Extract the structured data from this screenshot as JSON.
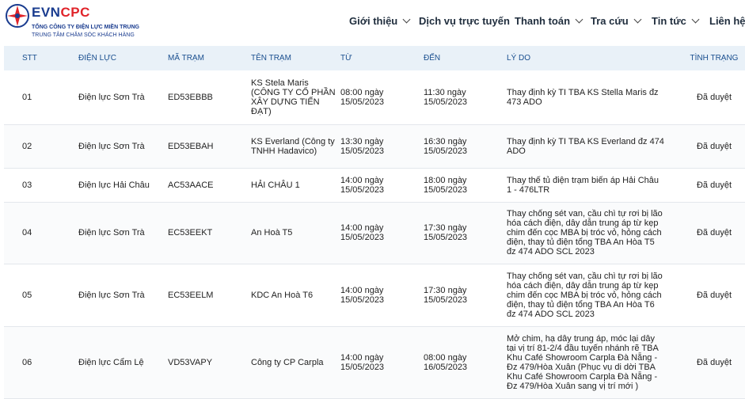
{
  "brand": {
    "evn": "EVN",
    "cpc": "CPC",
    "company": "TỔNG CÔNG TY ĐIỆN LỰC MIỀN TRUNG",
    "center": "TRUNG TÂM CHĂM SÓC KHÁCH HÀNG"
  },
  "nav": {
    "items": [
      {
        "label": "Giới thiệu",
        "dropdown": true
      },
      {
        "label": "Dịch vụ trực tuyến",
        "dropdown": false
      },
      {
        "label": "Thanh toán",
        "dropdown": true
      },
      {
        "label": "Tra cứu",
        "dropdown": true
      },
      {
        "label": "Tin tức",
        "dropdown": true
      },
      {
        "label": "Liên hệ",
        "dropdown": false
      }
    ]
  },
  "table": {
    "headers": [
      "STT",
      "ĐIỆN LỰC",
      "MÃ TRẠM",
      "TÊN TRẠM",
      "TỪ",
      "ĐẾN",
      "LÝ DO",
      "TÌNH TRẠNG"
    ],
    "rows": [
      {
        "stt": "01",
        "dien_luc": "Điện lực Sơn Trà",
        "ma_tram": "ED53EBBB",
        "ten_tram": "KS Stela Maris (CÔNG TY CỔ PHẦN XÂY DỰNG TIẾN ĐẠT)",
        "tu": "08:00 ngày 15/05/2023",
        "den": "11:30 ngày 15/05/2023",
        "ly_do": "Thay định kỳ TI TBA KS Stella Maris đz 473 ADO",
        "tinh_trang": "Đã duyệt"
      },
      {
        "stt": "02",
        "dien_luc": "Điện lực Sơn Trà",
        "ma_tram": "ED53EBAH",
        "ten_tram": "KS Everland (Công ty TNHH Hadavico)",
        "tu": "13:30 ngày 15/05/2023",
        "den": "16:30 ngày 15/05/2023",
        "ly_do": "Thay định kỳ TI TBA KS Everland đz 474 ADO",
        "tinh_trang": "Đã duyệt"
      },
      {
        "stt": "03",
        "dien_luc": "Điện lực Hải Châu",
        "ma_tram": "AC53AACE",
        "ten_tram": "HẢI CHÂU 1",
        "tu": "14:00 ngày 15/05/2023",
        "den": "18:00 ngày 15/05/2023",
        "ly_do": "Thay thế tủ điện trạm biến áp Hải Châu 1 - 476LTR",
        "tinh_trang": "Đã duyệt"
      },
      {
        "stt": "04",
        "dien_luc": "Điện lực Sơn Trà",
        "ma_tram": "EC53EEKT",
        "ten_tram": "An Hoà T5",
        "tu": "14:00 ngày 15/05/2023",
        "den": "17:30 ngày 15/05/2023",
        "ly_do": "Thay chống sét van, cầu chì tự rơi bị lão hóa cách điện, dây dẫn trung áp từ kẹp chim đến cọc MBA bị tróc vỏ, hỏng cách điện, thay tủ điện tổng TBA An Hòa T5 đz 474 ADO SCL 2023",
        "tinh_trang": "Đã duyệt"
      },
      {
        "stt": "05",
        "dien_luc": "Điện lực Sơn Trà",
        "ma_tram": "EC53EELM",
        "ten_tram": "KDC An Hoà T6",
        "tu": "14:00 ngày 15/05/2023",
        "den": "17:30 ngày 15/05/2023",
        "ly_do": "Thay chống sét van, cầu chì tự rơi bị lão hóa cách điện, dây dẫn trung áp từ kẹp chim đến cọc MBA bị tróc vỏ, hỏng cách điện, thay tủ điện tổng TBA An Hòa T6 đz 474 ADO SCL 2023",
        "tinh_trang": "Đã duyệt"
      },
      {
        "stt": "06",
        "dien_luc": "Điện lực Cẩm Lệ",
        "ma_tram": "VD53VAPY",
        "ten_tram": "Công ty CP Carpla",
        "tu": "14:00 ngày 15/05/2023",
        "den": "08:00 ngày 16/05/2023",
        "ly_do": "Mở chim, hạ dây trung áp, móc lại dây tại vị trí 81-2/4 đầu tuyến nhánh rẽ TBA Khu Café Showroom Carpla Đà Nẵng - Đz 479/Hòa Xuân (Phục vụ di dời TBA Khu Café Showroom Carpla Đà Nẵng - Đz 479/Hòa Xuân sang vị trí mới )",
        "tinh_trang": "Đã duyệt"
      }
    ]
  },
  "colors": {
    "brand_blue": "#1a3c8f",
    "brand_red": "#e0242a",
    "header_bg": "#e9f1f8",
    "header_text": "#1a4f8f"
  }
}
